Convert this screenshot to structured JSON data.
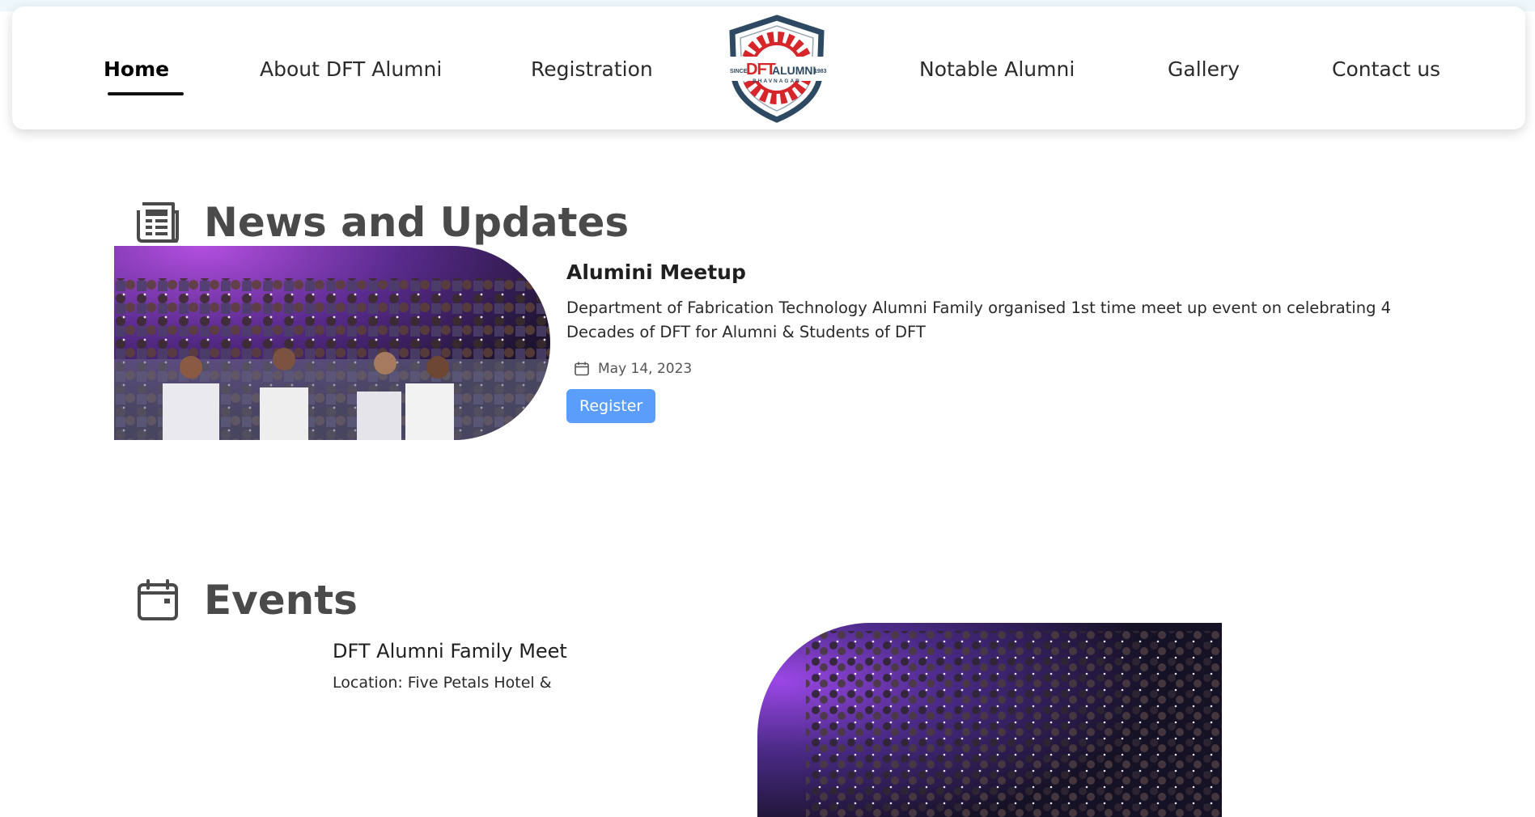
{
  "nav": {
    "left_links": [
      "Home",
      "About DFT Alumni",
      "Registration"
    ],
    "right_links": [
      "Notable Alumni",
      "Gallery",
      "Contact us"
    ],
    "active": "Home",
    "logo": {
      "since": "SINCE",
      "brand_dft": "DFT",
      "brand_alumni": "ALUMNI",
      "year": "1983",
      "city": "BHAVNAGAR"
    }
  },
  "news": {
    "heading": "News and Updates",
    "icon": "newspaper-icon",
    "item": {
      "title": "Alumini Meetup",
      "description": "Department of Fabrication Technology Alumni Family organised 1st time meet up event on celebrating 4 Decades of DFT for Alumni & Students of DFT",
      "date": "May 14, 2023",
      "register_label": "Register"
    }
  },
  "events": {
    "heading": "Events",
    "icon": "calendar-icon",
    "item": {
      "title": "DFT Alumni Family Meet",
      "location": "Location: Five Petals Hotel &"
    }
  },
  "colors": {
    "accent_button": "#5b9dfb",
    "heading_text": "#4a4a4a",
    "logo_red": "#d7262b",
    "logo_navy": "#2e4a62"
  }
}
